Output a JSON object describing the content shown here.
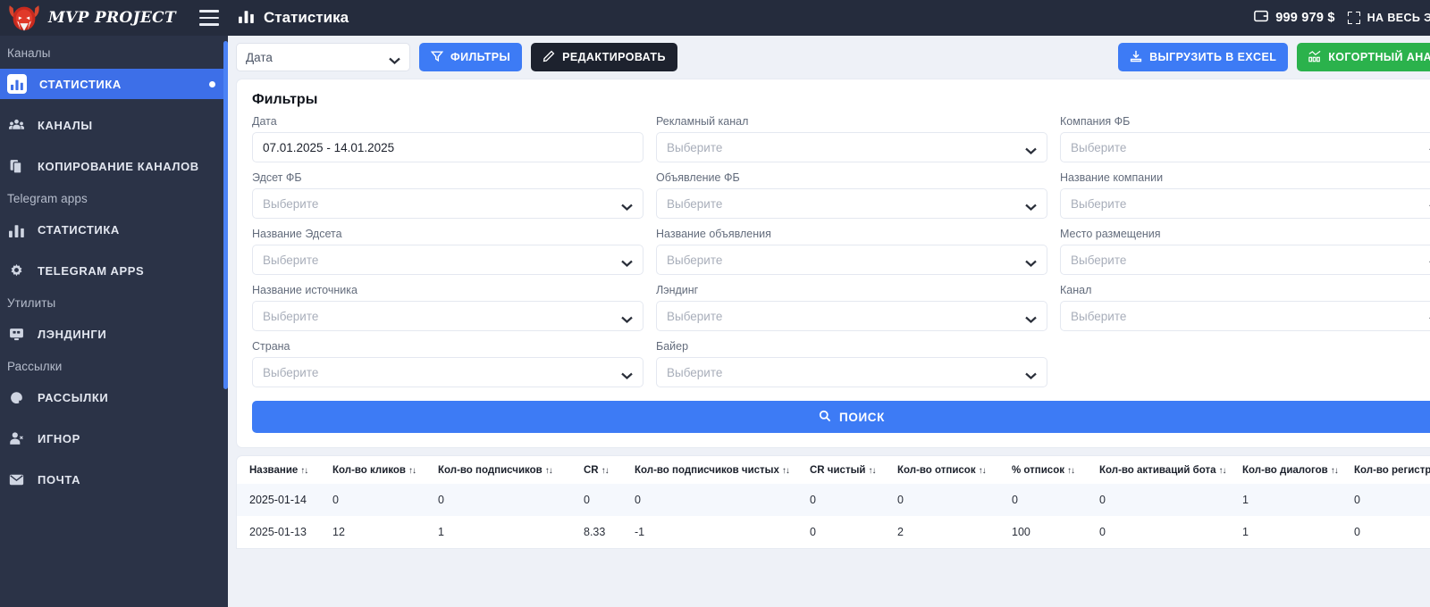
{
  "brand": {
    "name": "MVP PROJECT",
    "logo_icon": "bull-head-logo",
    "menu_icon": "hamburger-menu-icon"
  },
  "sidebar": {
    "scrollbar_color": "#4b82f5",
    "groups": [
      {
        "label": "Каналы",
        "items": [
          {
            "label": "СТАТИСТИКА",
            "icon": "bar-chart-icon",
            "active": true,
            "badge_dot": true
          },
          {
            "label": "КАНАЛЫ",
            "icon": "users-group-icon",
            "active": false
          },
          {
            "label": "КОПИРОВАНИЕ КАНАЛОВ",
            "icon": "copy-files-icon",
            "active": false
          }
        ]
      },
      {
        "label": "Telegram apps",
        "items": [
          {
            "label": "СТАТИСТИКА",
            "icon": "bar-chart-icon",
            "active": false
          },
          {
            "label": "TELEGRAM APPS",
            "icon": "gear-icon",
            "active": false
          }
        ]
      },
      {
        "label": "Утилиты",
        "items": [
          {
            "label": "ЛЭНДИНГИ",
            "icon": "monitor-icon",
            "active": false
          }
        ]
      },
      {
        "label": "Рассылки",
        "items": [
          {
            "label": "РАССЫЛКИ",
            "icon": "at-sign-icon",
            "active": false
          },
          {
            "label": "ИГНОР",
            "icon": "user-remove-icon",
            "active": false
          },
          {
            "label": "ПОЧТА",
            "icon": "envelope-icon",
            "active": false
          }
        ]
      }
    ]
  },
  "topbar": {
    "title": "Статистика",
    "title_icon": "bar-chart-icon",
    "balance": "999 979 $",
    "balance_icon": "wallet-icon",
    "fullscreen_label": "НА ВЕСЬ ЭКРАН",
    "fullscreen_icon": "fullscreen-icon"
  },
  "toolbar": {
    "date_select_value": "Дата",
    "filters_label": "ФИЛЬТРЫ",
    "filters_icon": "funnel-icon",
    "edit_label": "РЕДАКТИРОВАТЬ",
    "edit_icon": "pencil-icon",
    "excel_label": "ВЫГРУЗИТЬ В EXCEL",
    "excel_icon": "download-icon",
    "cohort_label": "КОГОРТНЫЙ АНАЛИЗ",
    "cohort_icon": "cohort-chart-icon",
    "colors": {
      "primary": "#3d7bf5",
      "dark": "#1d222e",
      "green": "#2bb24c"
    }
  },
  "filters": {
    "title": "Фильтры",
    "close_icon": "close-circle-icon",
    "placeholder": "Выберите",
    "search_label": "ПОИСК",
    "search_icon": "search-icon",
    "fields": [
      {
        "label": "Дата",
        "value": "07.01.2025 - 14.01.2025",
        "has_chevron": false
      },
      {
        "label": "Рекламный канал",
        "value": "",
        "has_chevron": true
      },
      {
        "label": "Компания ФБ",
        "value": "",
        "has_chevron": true
      },
      {
        "label": "Эдсет ФБ",
        "value": "",
        "has_chevron": true
      },
      {
        "label": "Объявление ФБ",
        "value": "",
        "has_chevron": true
      },
      {
        "label": "Название компании",
        "value": "",
        "has_chevron": true
      },
      {
        "label": "Название Эдсета",
        "value": "",
        "has_chevron": true
      },
      {
        "label": "Название объявления",
        "value": "",
        "has_chevron": true
      },
      {
        "label": "Место размещения",
        "value": "",
        "has_chevron": true
      },
      {
        "label": "Название источника",
        "value": "",
        "has_chevron": true
      },
      {
        "label": "Лэндинг",
        "value": "",
        "has_chevron": true
      },
      {
        "label": "Канал",
        "value": "",
        "has_chevron": true
      },
      {
        "label": "Страна",
        "value": "",
        "has_chevron": true
      },
      {
        "label": "Байер",
        "value": "",
        "has_chevron": true
      }
    ]
  },
  "table": {
    "sort_glyph": "↑↓",
    "columns": [
      "Название",
      "Кол-во кликов",
      "Кол-во подписчиков",
      "CR",
      "Кол-во подписчиков чистых",
      "CR чистый",
      "Кол-во отписок",
      "% отписок",
      "Кол-во активаций бота",
      "Кол-во диалогов",
      "Кол-во регистраций"
    ],
    "rows": [
      [
        "2025-01-14",
        "0",
        "0",
        "0",
        "0",
        "0",
        "0",
        "0",
        "0",
        "1",
        "0"
      ],
      [
        "2025-01-13",
        "12",
        "1",
        "8.33",
        "-1",
        "0",
        "2",
        "100",
        "0",
        "1",
        "0"
      ]
    ]
  }
}
